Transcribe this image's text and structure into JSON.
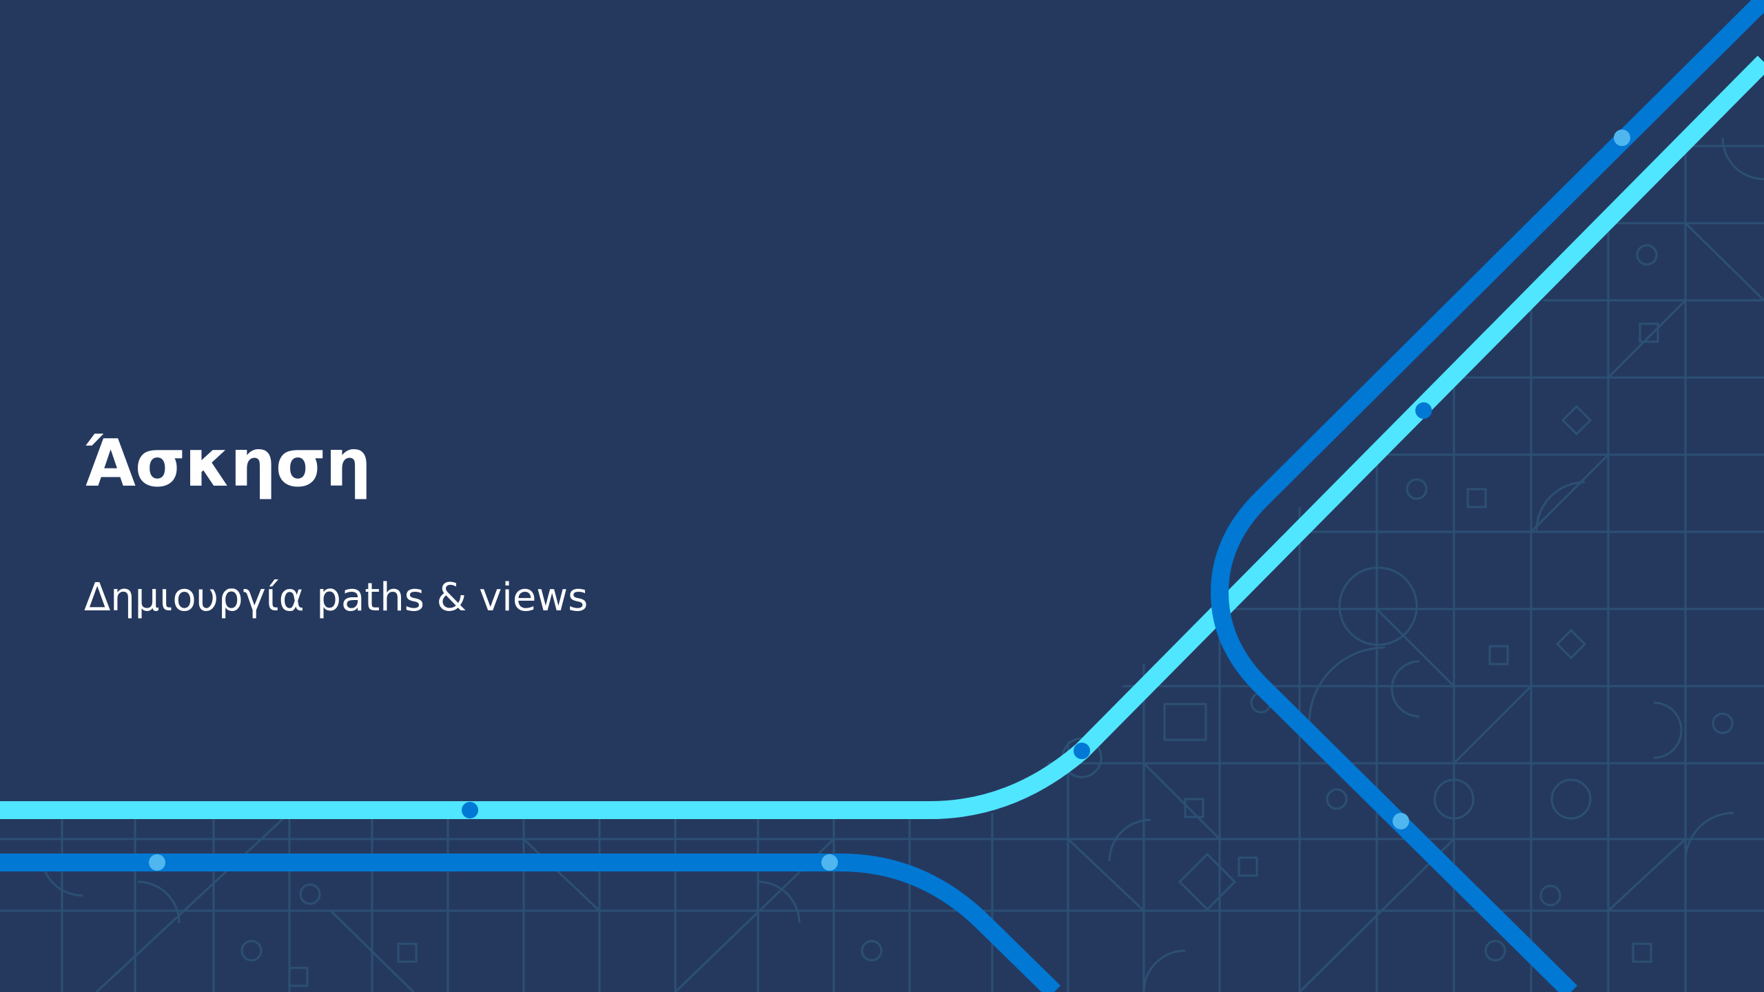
{
  "slide": {
    "title": "Άσκηση",
    "subtitle": "Δημιουργία paths & views"
  },
  "colors": {
    "background": "#25395f",
    "line_light": "#50e6ff",
    "line_blue": "#0078d4",
    "circuit_pattern": "#2e5577",
    "text": "#ffffff"
  }
}
